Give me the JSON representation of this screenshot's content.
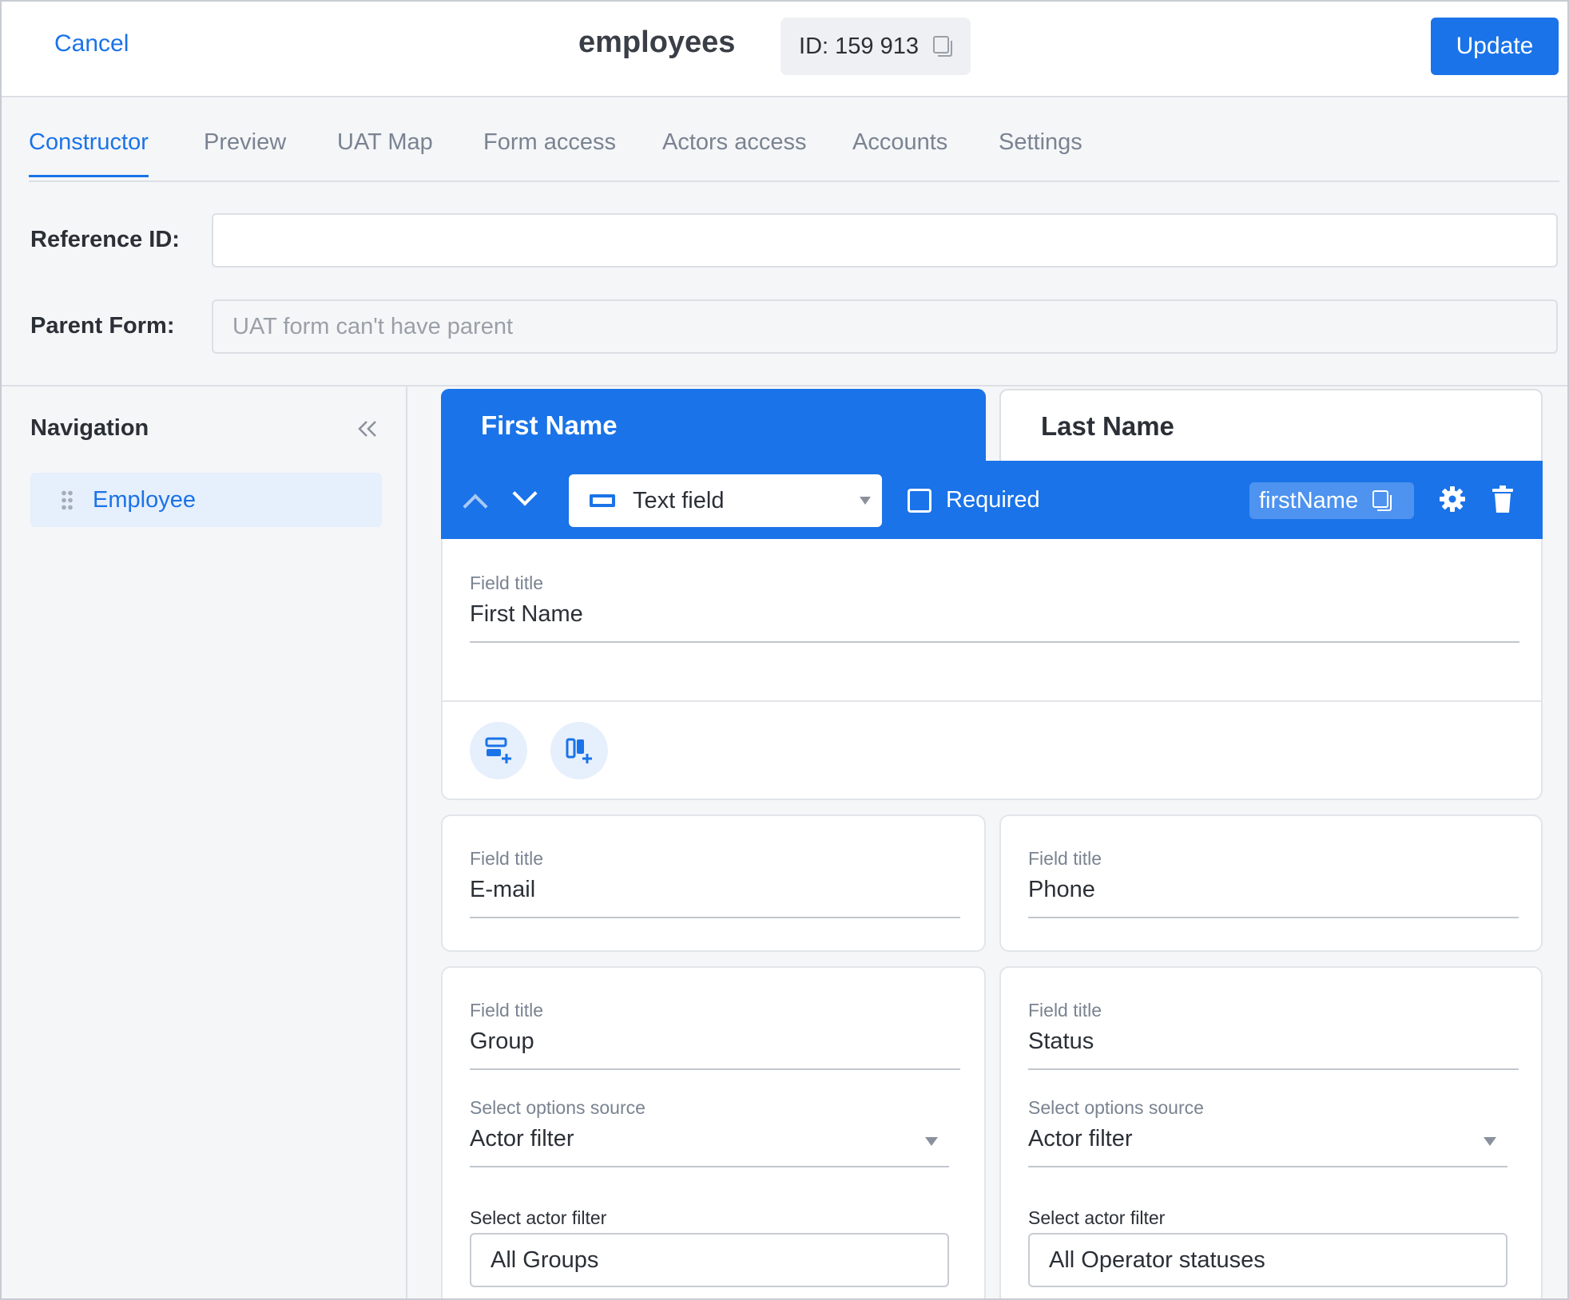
{
  "header": {
    "cancel_label": "Cancel",
    "title": "employees",
    "id_label": "ID: 159 913",
    "update_label": "Update"
  },
  "tabs": [
    {
      "label": "Constructor",
      "active": true
    },
    {
      "label": "Preview"
    },
    {
      "label": "UAT Map"
    },
    {
      "label": "Form access"
    },
    {
      "label": "Actors access"
    },
    {
      "label": "Accounts"
    },
    {
      "label": "Settings"
    }
  ],
  "form": {
    "reference_label": "Reference ID:",
    "reference_value": "",
    "parent_label": "Parent Form:",
    "parent_placeholder": "UAT form can't have parent"
  },
  "nav": {
    "title": "Navigation",
    "items": [
      {
        "label": "Employee"
      }
    ]
  },
  "sections": [
    {
      "label": "First Name",
      "active": true
    },
    {
      "label": "Last Name"
    }
  ],
  "toolbar": {
    "type_label": "Text field",
    "required_label": "Required",
    "key_label": "firstName"
  },
  "fields": {
    "first_name": {
      "title_label": "Field title",
      "title_value": "First Name"
    },
    "email": {
      "title_label": "Field title",
      "title_value": "E-mail"
    },
    "phone": {
      "title_label": "Field title",
      "title_value": "Phone"
    },
    "group": {
      "title_label": "Field title",
      "title_value": "Group",
      "source_label": "Select options source",
      "source_value": "Actor filter",
      "filter_label": "Select actor filter",
      "filter_value": "All Groups"
    },
    "status": {
      "title_label": "Field title",
      "title_value": "Status",
      "source_label": "Select options source",
      "source_value": "Actor filter",
      "filter_label": "Select actor filter",
      "filter_value": "All Operator statuses"
    }
  },
  "colors": {
    "accent": "#1a73e8",
    "background": "#f5f6f8"
  }
}
